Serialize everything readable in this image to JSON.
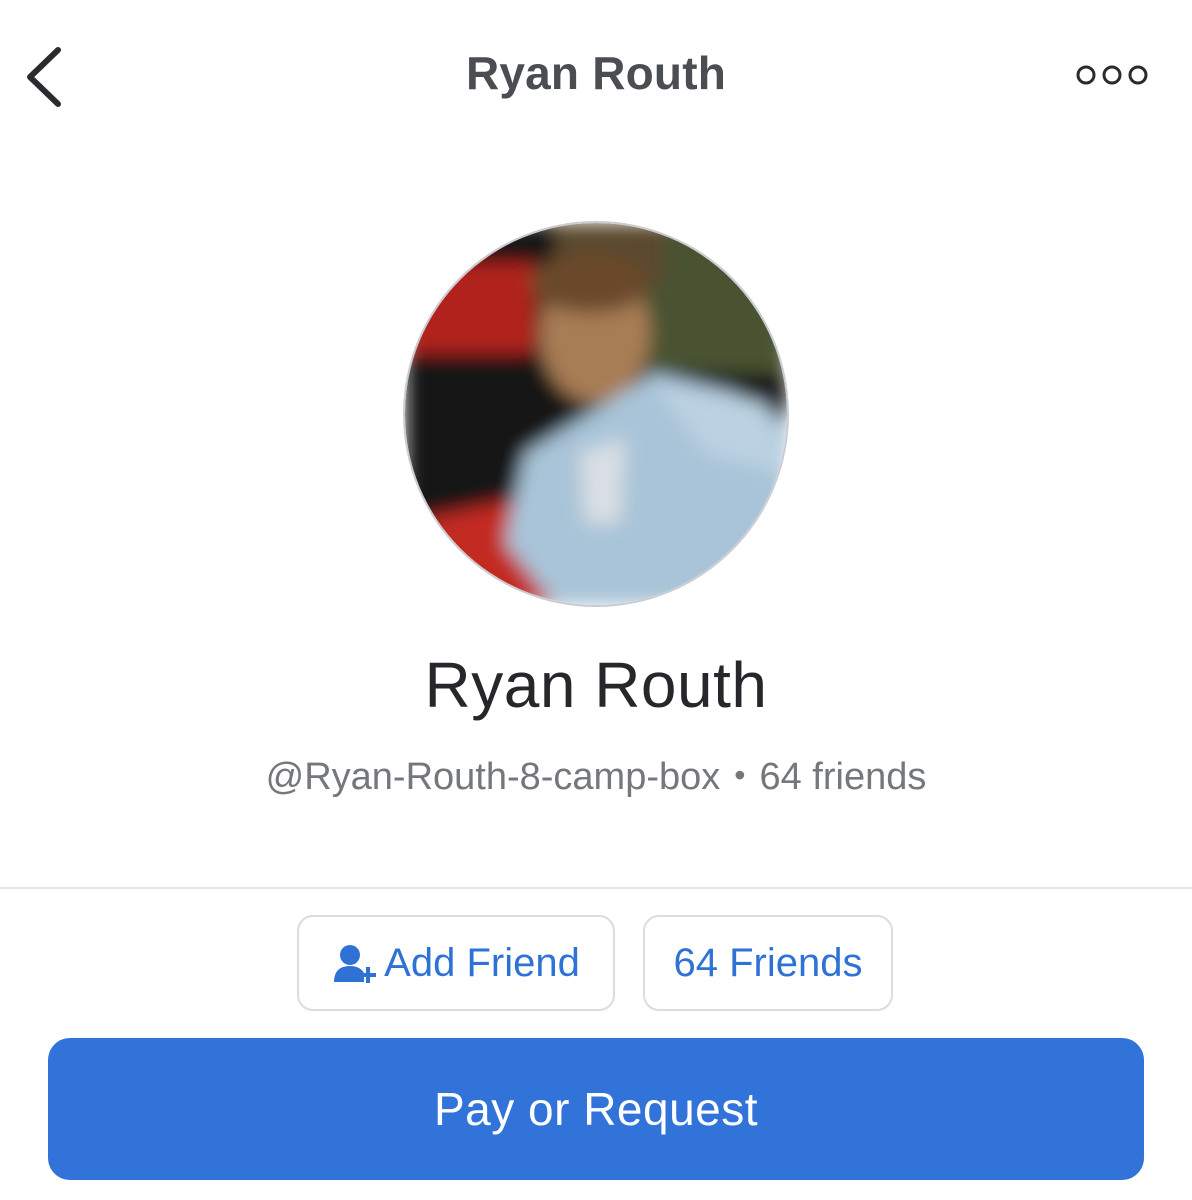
{
  "nav": {
    "title": "Ryan Routh"
  },
  "icons": {
    "back": "chevron-left-icon",
    "more": "more-horizontal-icon",
    "add_friend": "add-friend-icon"
  },
  "profile": {
    "name": "Ryan Routh",
    "username": "@Ryan-Routh-8-camp-box",
    "separator": "•",
    "friends_count_text": "64 friends"
  },
  "actions": {
    "add_friend_label": "Add Friend",
    "friends_label": "64 Friends",
    "pay_label": "Pay or Request"
  },
  "colors": {
    "accent": "#3173d8",
    "link": "#2f72d6",
    "divider": "#e3e5e8"
  }
}
